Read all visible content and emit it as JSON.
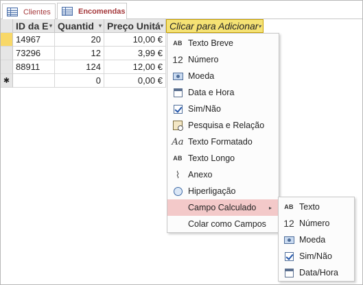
{
  "tabs": [
    {
      "label": "Clientes",
      "icon": "table-icon",
      "active": false
    },
    {
      "label": "Encomendas",
      "icon": "table-icon",
      "active": true
    }
  ],
  "columns": [
    {
      "label": "ID da E",
      "dropdown": "▾"
    },
    {
      "label": "Quantid",
      "dropdown": "▾"
    },
    {
      "label": "Preço Unitá",
      "dropdown": "▾"
    },
    {
      "label": "Clicar para Adicionar",
      "dropdown": "▾"
    }
  ],
  "rows": [
    {
      "selector": "",
      "id": "14967",
      "qty": "20",
      "price": "10,00 €"
    },
    {
      "selector": "",
      "id": "73296",
      "qty": "12",
      "price": "3,99 €"
    },
    {
      "selector": "",
      "id": "88911",
      "qty": "124",
      "price": "12,00 €"
    },
    {
      "selector": "✱",
      "id": "",
      "qty": "0",
      "price": "0,00 €"
    }
  ],
  "field_type_menu": {
    "items": [
      {
        "label": "Texto Breve",
        "icon": "ab-icon"
      },
      {
        "label": "Número",
        "icon": "number-icon"
      },
      {
        "label": "Moeda",
        "icon": "currency-icon"
      },
      {
        "label": "Data e Hora",
        "icon": "calendar-icon"
      },
      {
        "label": "Sim/Não",
        "icon": "checkbox-icon"
      },
      {
        "label": "Pesquisa e Relação",
        "icon": "lookup-icon"
      },
      {
        "label": "Texto Formatado",
        "icon": "formatted-text-icon"
      },
      {
        "label": "Texto Longo",
        "icon": "ab-icon"
      },
      {
        "label": "Anexo",
        "icon": "paperclip-icon"
      },
      {
        "label": "Hiperligação",
        "icon": "globe-icon"
      },
      {
        "label": "Campo Calculado",
        "icon": "",
        "submenu": true
      },
      {
        "label": "Colar como Campos",
        "icon": ""
      }
    ]
  },
  "calculated_submenu": {
    "items": [
      {
        "label": "Texto",
        "icon": "ab-icon"
      },
      {
        "label": "Número",
        "icon": "number-icon"
      },
      {
        "label": "Moeda",
        "icon": "currency-icon"
      },
      {
        "label": "Sim/Não",
        "icon": "checkbox-icon"
      },
      {
        "label": "Data/Hora",
        "icon": "calendar-icon"
      }
    ]
  },
  "icon_glyphs": {
    "ab": "AB",
    "number": "12",
    "formatted": "Aa",
    "clip": "⌇",
    "arrow": "▸"
  },
  "colors": {
    "tab_text": "#a4373a",
    "add_column_header": "#f5e274",
    "current_row_selector": "#f8d868",
    "menu_highlight": "#f3c9c9"
  }
}
